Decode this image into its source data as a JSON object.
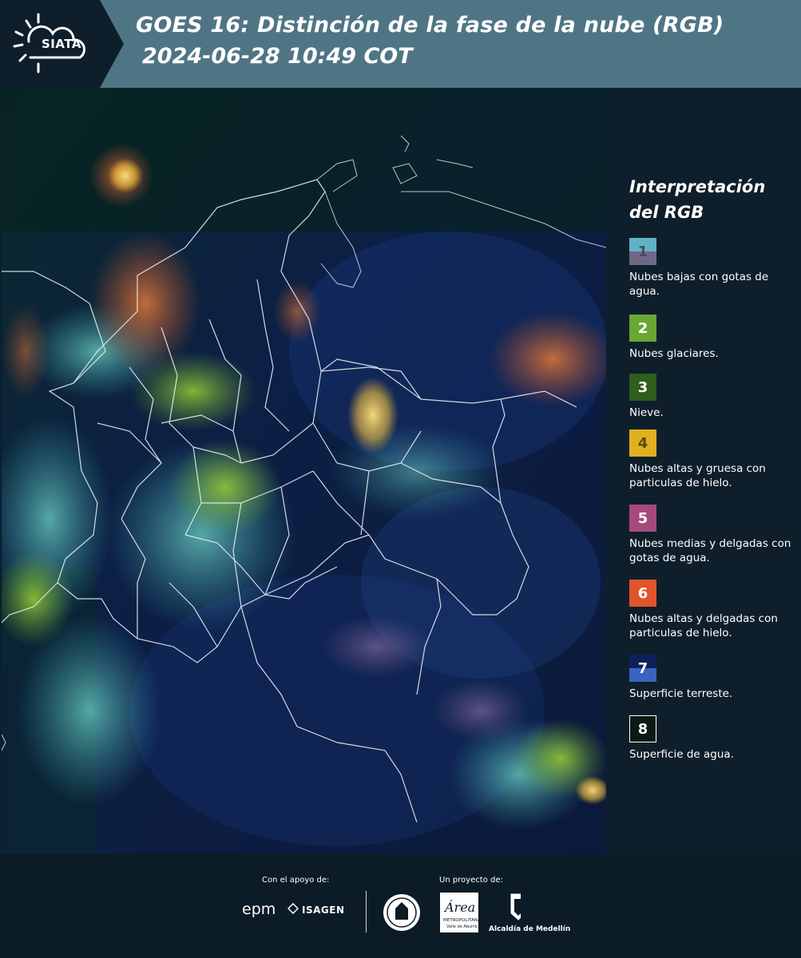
{
  "header": {
    "logo_text": "SIATA",
    "title": "GOES 16: Distinción de la fase de la nube (RGB)",
    "subtitle": "2024-06-28 10:49 COT",
    "background": "#4f7585"
  },
  "legend": {
    "title_line1": "Interpretación",
    "title_line2": "del RGB",
    "items": [
      {
        "num": "1",
        "label": "Nubes bajas con gotas de agua.",
        "color_top": "#5fb3c4",
        "color_bottom": "#6e6a86"
      },
      {
        "num": "2",
        "label": "Nubes glaciares.",
        "color": "#6aa634"
      },
      {
        "num": "3",
        "label": "Nieve.",
        "color": "#2f5e1e"
      },
      {
        "num": "4",
        "label": "Nubes altas y gruesa con particulas de hielo.",
        "color": "#e0b020"
      },
      {
        "num": "5",
        "label": "Nubes medias y delgadas con gotas de agua.",
        "color": "#a64a7e"
      },
      {
        "num": "6",
        "label": "Nubes altas y delgadas con particulas de hielo.",
        "color": "#e2542a"
      },
      {
        "num": "7",
        "label": "Superficie terreste.",
        "color_top": "#0f1f5c",
        "color_bottom": "#3a63bd"
      },
      {
        "num": "8",
        "label": "Superficie de agua.",
        "color": "#0a1a14"
      }
    ]
  },
  "footer": {
    "support_label": "Con el apoyo de:",
    "project_label": "Un proyecto de:",
    "sponsor1": "epm",
    "sponsor2": "ISAGEN",
    "partner1": "Área Metropolitana Valle de Aburrá",
    "partner2": "Alcaldía de Medellín"
  }
}
